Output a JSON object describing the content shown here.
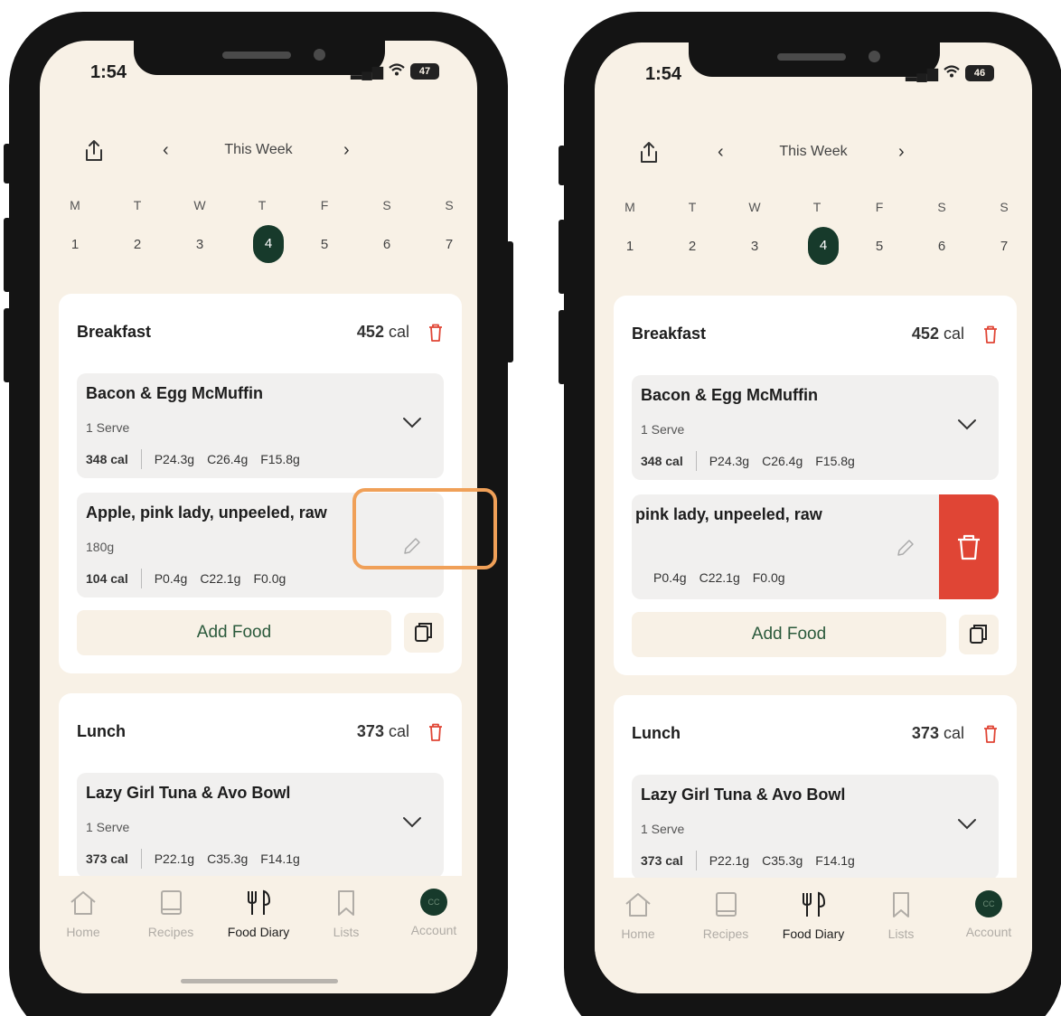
{
  "phones": [
    {
      "time": "1:54",
      "battery": "47",
      "week_title": "This Week",
      "days": [
        {
          "letter": "M",
          "num": "1"
        },
        {
          "letter": "T",
          "num": "2"
        },
        {
          "letter": "W",
          "num": "3"
        },
        {
          "letter": "T",
          "num": "4"
        },
        {
          "letter": "F",
          "num": "5"
        },
        {
          "letter": "S",
          "num": "6"
        },
        {
          "letter": "S",
          "num": "7"
        }
      ],
      "active_day": "4",
      "breakfast": {
        "title": "Breakfast",
        "cal_value": "452",
        "cal_unit": "cal",
        "item1": {
          "name": "Bacon & Egg McMuffin",
          "qty": "1 Serve",
          "kcal": "348 cal",
          "p": "P24.3g",
          "c": "C26.4g",
          "f": "F15.8g"
        },
        "item2": {
          "name": "Apple, pink lady, unpeeled, raw",
          "qty": "180g",
          "kcal": "104 cal",
          "p": "P0.4g",
          "c": "C22.1g",
          "f": "F0.0g"
        },
        "add_food": "Add Food"
      },
      "lunch": {
        "title": "Lunch",
        "cal_value": "373",
        "cal_unit": "cal",
        "item1": {
          "name": "Lazy Girl Tuna & Avo Bowl",
          "qty": "1 Serve",
          "kcal": "373 cal",
          "p": "P22.1g",
          "c": "C35.3g",
          "f": "F14.1g"
        }
      },
      "tabs": [
        "Home",
        "Recipes",
        "Food Diary",
        "Lists",
        "Account"
      ],
      "avatar": "CC"
    },
    {
      "time": "1:54",
      "battery": "46",
      "week_title": "This Week",
      "days": [
        {
          "letter": "M",
          "num": "1"
        },
        {
          "letter": "T",
          "num": "2"
        },
        {
          "letter": "W",
          "num": "3"
        },
        {
          "letter": "T",
          "num": "4"
        },
        {
          "letter": "F",
          "num": "5"
        },
        {
          "letter": "S",
          "num": "6"
        },
        {
          "letter": "S",
          "num": "7"
        }
      ],
      "active_day": "4",
      "breakfast": {
        "title": "Breakfast",
        "cal_value": "452",
        "cal_unit": "cal",
        "item1": {
          "name": "Bacon & Egg McMuffin",
          "qty": "1 Serve",
          "kcal": "348 cal",
          "p": "P24.3g",
          "c": "C26.4g",
          "f": "F15.8g"
        },
        "item2": {
          "name": "pink lady, unpeeled, raw",
          "p": "P0.4g",
          "c": "C22.1g",
          "f": "F0.0g"
        },
        "add_food": "Add Food"
      },
      "lunch": {
        "title": "Lunch",
        "cal_value": "373",
        "cal_unit": "cal",
        "item1": {
          "name": "Lazy Girl Tuna & Avo Bowl",
          "qty": "1 Serve",
          "kcal": "373 cal",
          "p": "P22.1g",
          "c": "C35.3g",
          "f": "F14.1g"
        }
      },
      "tabs": [
        "Home",
        "Recipes",
        "Food Diary",
        "Lists",
        "Account"
      ],
      "avatar": "CC"
    }
  ],
  "colors": {
    "background": "#f8f1e6",
    "accent_green": "#173a2b",
    "delete_red": "#e04535",
    "highlight_orange": "#f0a058"
  }
}
